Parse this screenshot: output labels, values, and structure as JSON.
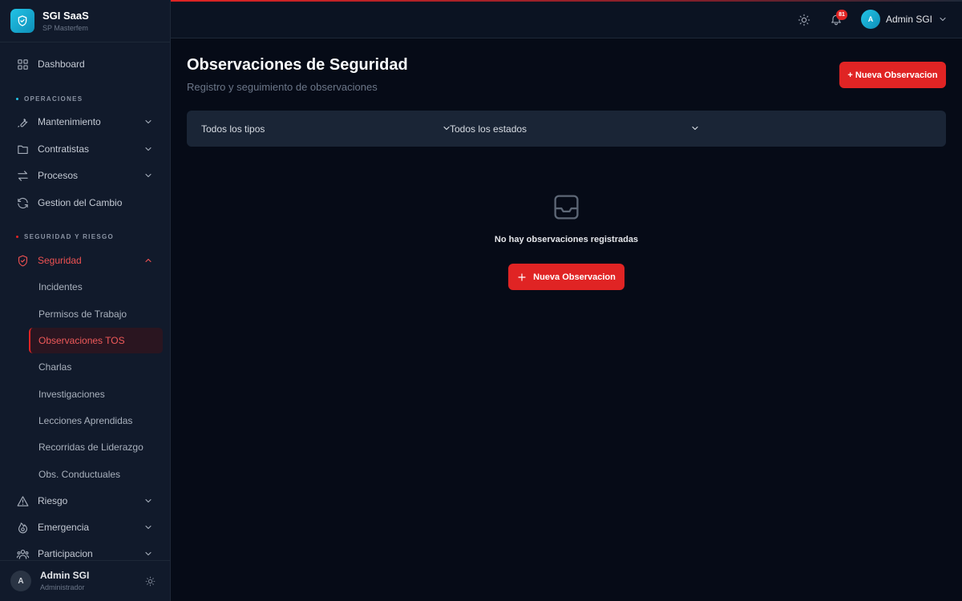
{
  "brand": {
    "title": "SGI SaaS",
    "subtitle": "SP Masterfem"
  },
  "sidebar": {
    "dashboard": "Dashboard",
    "sections": {
      "operaciones": "OPERACIONES",
      "seguridad_riesgo": "SEGURIDAD Y RIESGO"
    },
    "items": {
      "mantenimiento": "Mantenimiento",
      "contratistas": "Contratistas",
      "procesos": "Procesos",
      "gestion_cambio": "Gestion del Cambio",
      "seguridad": "Seguridad",
      "riesgo": "Riesgo",
      "emergencia": "Emergencia",
      "participacion": "Participacion"
    },
    "seguridad_sub": {
      "incidentes": "Incidentes",
      "permisos": "Permisos de Trabajo",
      "observaciones": "Observaciones TOS",
      "charlas": "Charlas",
      "investigaciones": "Investigaciones",
      "lecciones": "Lecciones Aprendidas",
      "recorridas": "Recorridas de Liderazgo",
      "conductuales": "Obs. Conductuales"
    },
    "footer": {
      "avatar": "A",
      "name": "Admin SGI",
      "role": "Administrador"
    }
  },
  "topbar": {
    "notifications_count": "81",
    "user_initial": "A",
    "user_name": "Admin SGI"
  },
  "main": {
    "title": "Observaciones de Seguridad",
    "subtitle": "Registro y seguimiento de observaciones",
    "new_button": "+ Nueva Observacion",
    "filters": {
      "tipo": "Todos los tipos",
      "estado": "Todos los estados"
    },
    "empty": {
      "message": "No hay observaciones registradas",
      "button": "Nueva Observacion"
    }
  },
  "icons": {
    "brand": "shield-check-icon",
    "dashboard": "grid-icon",
    "mantenimiento": "wrench-icon",
    "contratistas": "folder-icon",
    "procesos": "arrows-icon",
    "gestion_cambio": "refresh-icon",
    "seguridad": "shield-icon",
    "riesgo": "warning-icon",
    "emergencia": "flame-icon",
    "participacion": "users-icon",
    "empty": "inbox-icon"
  },
  "colors": {
    "accent": "#e02424",
    "brand": "#22c3e6",
    "background": "#060b17",
    "sidebar": "#111a2b"
  }
}
